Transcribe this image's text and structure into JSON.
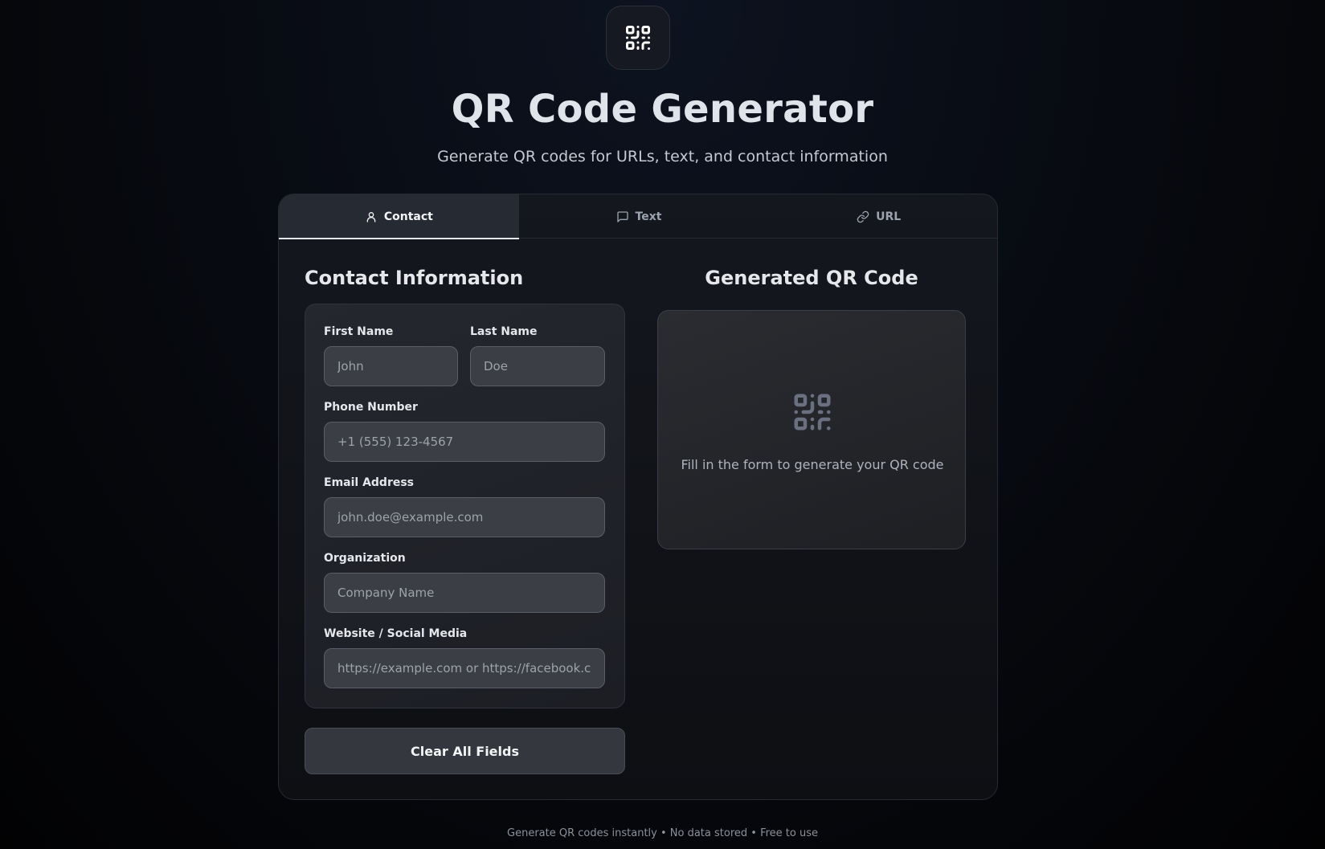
{
  "header": {
    "logo_icon": "qr-code-icon",
    "title": "QR Code Generator",
    "subtitle": "Generate QR codes for URLs, text, and contact information"
  },
  "tabs": [
    {
      "label": "Contact",
      "icon": "user-icon",
      "active": true
    },
    {
      "label": "Text",
      "icon": "message-icon",
      "active": false
    },
    {
      "label": "URL",
      "icon": "link-icon",
      "active": false
    }
  ],
  "contact_form": {
    "title": "Contact Information",
    "first_name": {
      "label": "First Name",
      "value": "",
      "placeholder": "John"
    },
    "last_name": {
      "label": "Last Name",
      "value": "",
      "placeholder": "Doe"
    },
    "phone": {
      "label": "Phone Number",
      "value": "",
      "placeholder": "+1 (555) 123-4567"
    },
    "email": {
      "label": "Email Address",
      "value": "",
      "placeholder": "john.doe@example.com"
    },
    "organization": {
      "label": "Organization",
      "value": "",
      "placeholder": "Company Name"
    },
    "website": {
      "label": "Website / Social Media",
      "value": "",
      "placeholder": "https://example.com or https://facebook.com"
    },
    "clear_label": "Clear All Fields"
  },
  "qr_output": {
    "title": "Generated QR Code",
    "placeholder_icon": "qr-code-icon",
    "hint": "Fill in the form to generate your QR code"
  },
  "footer": {
    "text": "Generate QR codes instantly • No data stored • Free to use"
  },
  "colors": {
    "background": "#05070b",
    "card": "#121419",
    "active_tab": "#262a33",
    "input_bg": "#3b3e45",
    "text": "#e5e7eb",
    "muted": "#9ca3af"
  }
}
